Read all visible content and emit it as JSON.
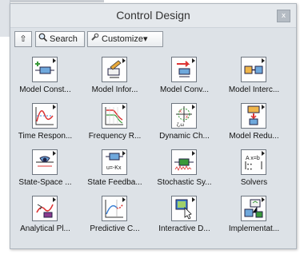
{
  "window": {
    "title": "Control Design",
    "close_label": "x"
  },
  "toolbar": {
    "up_label": "⇧",
    "search_label": "Search",
    "customize_label": "Customize▾"
  },
  "items": [
    {
      "label": "Model Const...",
      "icon": "model-construction-icon"
    },
    {
      "label": "Model Infor...",
      "icon": "model-information-icon"
    },
    {
      "label": "Model Conv...",
      "icon": "model-conversion-icon"
    },
    {
      "label": "Model Interc...",
      "icon": "model-interconnection-icon"
    },
    {
      "label": "Time Respon...",
      "icon": "time-response-icon"
    },
    {
      "label": "Frequency R...",
      "icon": "frequency-response-icon"
    },
    {
      "label": "Dynamic Ch...",
      "icon": "dynamic-characteristics-icon"
    },
    {
      "label": "Model Redu...",
      "icon": "model-reduction-icon"
    },
    {
      "label": "State-Space ...",
      "icon": "state-space-icon"
    },
    {
      "label": "State Feedba...",
      "icon": "state-feedback-icon"
    },
    {
      "label": "Stochastic Sy...",
      "icon": "stochastic-systems-icon"
    },
    {
      "label": "Solvers",
      "icon": "solvers-icon"
    },
    {
      "label": "Analytical Pl...",
      "icon": "analytical-plant-icon"
    },
    {
      "label": "Predictive C...",
      "icon": "predictive-control-icon"
    },
    {
      "label": "Interactive D...",
      "icon": "interactive-design-icon"
    },
    {
      "label": "Implementat...",
      "icon": "implementation-icon"
    }
  ]
}
